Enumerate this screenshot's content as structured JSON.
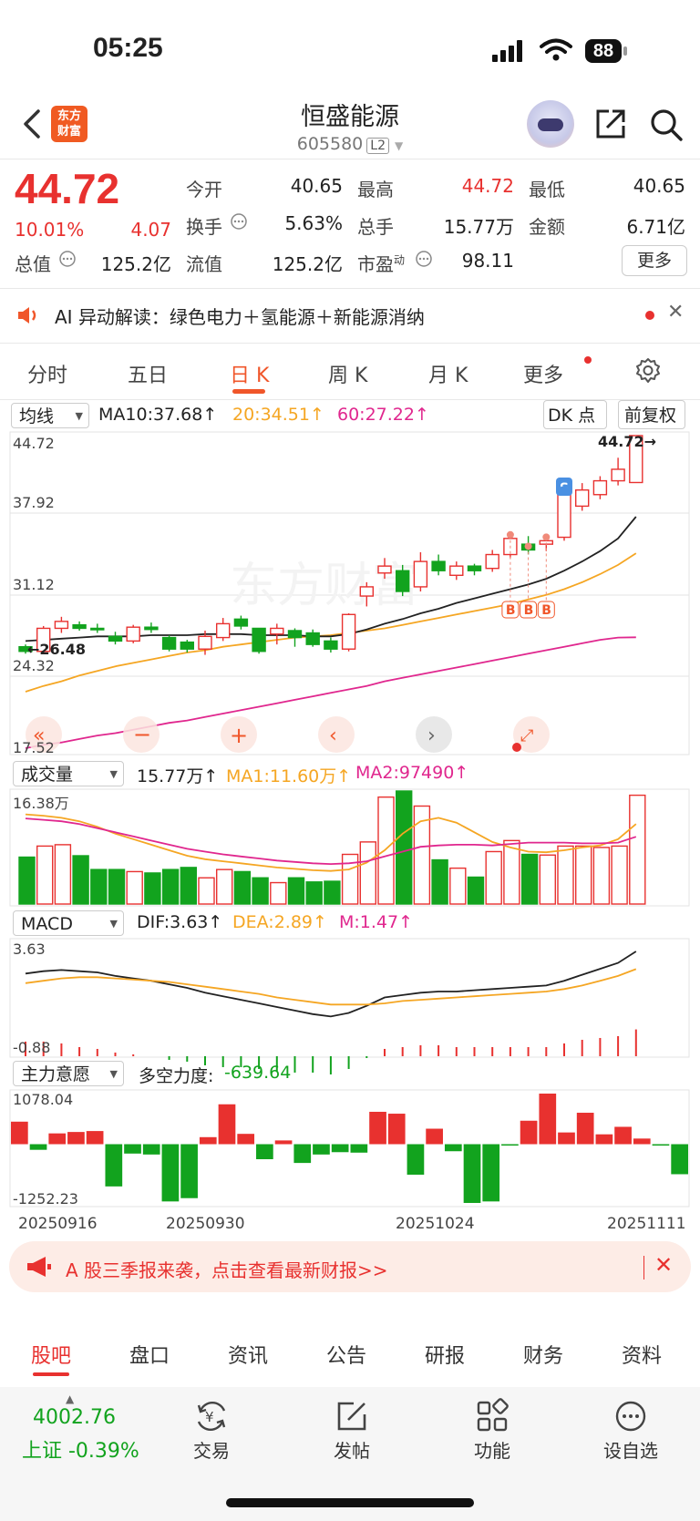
{
  "status": {
    "time": "05:25",
    "battery": "88"
  },
  "header": {
    "name": "恒盛能源",
    "code": "605580",
    "level": "L2",
    "logo_line1": "东方",
    "logo_line2": "财富"
  },
  "quote": {
    "price": "44.72",
    "pct": "10.01%",
    "chg": "4.07",
    "stats": [
      {
        "label": "今开",
        "value": "40.65"
      },
      {
        "label": "最高",
        "value": "44.72"
      },
      {
        "label": "最低",
        "value": "40.65"
      },
      {
        "label": "换手",
        "value": "5.63%"
      },
      {
        "label": "总手",
        "value": "15.77万"
      },
      {
        "label": "金额",
        "value": "6.71亿"
      },
      {
        "label": "总值",
        "value": "125.2亿"
      },
      {
        "label": "流值",
        "value": "125.2亿"
      },
      {
        "label": "市盈",
        "sup": "动",
        "value": "98.11"
      }
    ],
    "more": "更多"
  },
  "ai": {
    "text": "AI 异动解读：绿色电力＋氢能源＋新能源消纳",
    "close": "✕"
  },
  "tabs": [
    "分时",
    "五日",
    "日 K",
    "周 K",
    "月 K",
    "更多"
  ],
  "kline": {
    "selector": "均线",
    "ma10": "MA10:37.68↑",
    "ma20": "20:34.51↑",
    "ma60": "60:27.22↑",
    "dk": "DK 点",
    "fq": "前复权",
    "ylabels": [
      "44.72",
      "37.92",
      "31.12",
      "24.32",
      "17.52"
    ],
    "high_label": "44.72→",
    "low_label": "←26.48",
    "watermark": "东方财富",
    "signal_s": "S",
    "signal_b": "B",
    "colors": {
      "up": "#e8312f",
      "down": "#12a31e",
      "ma10": "#222222",
      "ma20": "#f5a623",
      "ma60": "#e0278e"
    }
  },
  "volume": {
    "selector": "成交量",
    "value": "15.77万↑",
    "ma1": "MA1:11.60万↑",
    "ma2": "MA2:97490↑",
    "ymax": "16.38万"
  },
  "macd": {
    "selector": "MACD",
    "dif": "DIF:3.63↑",
    "dea": "DEA:2.89↑",
    "m": "M:1.47↑",
    "ymax": "3.63",
    "ymin": "-0.88"
  },
  "mainforce": {
    "selector": "主力意愿",
    "label": "多空力度:",
    "value": "-639.64",
    "ymax": "1078.04",
    "ymin": "-1252.23"
  },
  "dates": [
    "20250916",
    "20250930",
    "20251024",
    "20251111"
  ],
  "chart_data": {
    "type": "candlestick",
    "candles": [
      {
        "o": 26.4,
        "c": 26.0,
        "h": 26.6,
        "l": 25.8
      },
      {
        "o": 26.0,
        "c": 28.0,
        "h": 28.2,
        "l": 25.8
      },
      {
        "o": 28.0,
        "c": 28.6,
        "h": 29.0,
        "l": 27.6
      },
      {
        "o": 28.3,
        "c": 28.0,
        "h": 28.6,
        "l": 27.8
      },
      {
        "o": 28.0,
        "c": 27.9,
        "h": 28.4,
        "l": 27.6
      },
      {
        "o": 27.3,
        "c": 26.9,
        "h": 27.7,
        "l": 26.6
      },
      {
        "o": 26.9,
        "c": 28.1,
        "h": 28.3,
        "l": 26.7
      },
      {
        "o": 28.1,
        "c": 27.9,
        "h": 28.5,
        "l": 27.6
      },
      {
        "o": 27.2,
        "c": 26.2,
        "h": 27.4,
        "l": 26.0
      },
      {
        "o": 26.8,
        "c": 26.2,
        "h": 27.0,
        "l": 25.9
      },
      {
        "o": 26.2,
        "c": 27.3,
        "h": 27.8,
        "l": 25.7
      },
      {
        "o": 27.2,
        "c": 28.4,
        "h": 28.9,
        "l": 26.9
      },
      {
        "o": 28.8,
        "c": 28.2,
        "h": 29.1,
        "l": 27.9
      },
      {
        "o": 28.0,
        "c": 26.0,
        "h": 28.0,
        "l": 25.8
      },
      {
        "o": 27.5,
        "c": 28.0,
        "h": 28.4,
        "l": 26.6
      },
      {
        "o": 27.8,
        "c": 27.2,
        "h": 28.0,
        "l": 26.4
      },
      {
        "o": 27.6,
        "c": 26.6,
        "h": 27.9,
        "l": 26.4
      },
      {
        "o": 26.9,
        "c": 26.2,
        "h": 27.2,
        "l": 25.9
      },
      {
        "o": 26.2,
        "c": 29.2,
        "h": 29.3,
        "l": 26.0
      },
      {
        "o": 30.8,
        "c": 31.6,
        "h": 32.0,
        "l": 29.9
      },
      {
        "o": 32.8,
        "c": 33.4,
        "h": 34.1,
        "l": 32.3
      },
      {
        "o": 33.0,
        "c": 31.2,
        "h": 33.5,
        "l": 30.8
      },
      {
        "o": 31.6,
        "c": 33.8,
        "h": 34.6,
        "l": 31.2
      },
      {
        "o": 33.8,
        "c": 33.0,
        "h": 34.4,
        "l": 32.6
      },
      {
        "o": 32.6,
        "c": 33.4,
        "h": 33.8,
        "l": 32.2
      },
      {
        "o": 33.4,
        "c": 33.0,
        "h": 33.6,
        "l": 32.6
      },
      {
        "o": 33.2,
        "c": 34.4,
        "h": 34.8,
        "l": 32.9
      },
      {
        "o": 34.4,
        "c": 35.8,
        "h": 36.3,
        "l": 34.1
      },
      {
        "o": 35.3,
        "c": 34.8,
        "h": 36.0,
        "l": 34.4
      },
      {
        "o": 35.3,
        "c": 35.6,
        "h": 36.1,
        "l": 34.7
      },
      {
        "o": 35.9,
        "c": 39.7,
        "h": 39.9,
        "l": 35.6
      },
      {
        "o": 38.6,
        "c": 40.0,
        "h": 40.6,
        "l": 38.2
      },
      {
        "o": 39.6,
        "c": 40.8,
        "h": 41.2,
        "l": 39.2
      },
      {
        "o": 40.8,
        "c": 41.8,
        "h": 42.8,
        "l": 40.4
      },
      {
        "o": 40.65,
        "c": 44.72,
        "h": 44.72,
        "l": 40.65
      }
    ],
    "ma10": [
      26.9,
      27.0,
      27.1,
      27.2,
      27.3,
      27.3,
      27.3,
      27.4,
      27.4,
      27.4,
      27.5,
      27.5,
      27.5,
      27.4,
      27.4,
      27.4,
      27.3,
      27.3,
      27.5,
      27.9,
      28.4,
      28.8,
      29.3,
      29.7,
      30.2,
      30.6,
      31.0,
      31.4,
      31.8,
      32.3,
      33.0,
      33.8,
      34.7,
      35.8,
      37.68
    ],
    "ma20": [
      22.5,
      23.0,
      23.4,
      23.9,
      24.3,
      24.7,
      25.0,
      25.3,
      25.6,
      25.9,
      26.1,
      26.4,
      26.6,
      26.8,
      27.0,
      27.2,
      27.3,
      27.4,
      27.6,
      27.8,
      28.0,
      28.3,
      28.6,
      28.9,
      29.2,
      29.5,
      29.8,
      30.1,
      30.5,
      30.9,
      31.4,
      32.0,
      32.7,
      33.5,
      34.51
    ],
    "ma60": [
      17.6,
      17.9,
      18.1,
      18.4,
      18.7,
      18.9,
      19.2,
      19.5,
      19.8,
      20.0,
      20.3,
      20.6,
      20.9,
      21.2,
      21.5,
      21.8,
      22.1,
      22.4,
      22.7,
      23.0,
      23.4,
      23.7,
      24.0,
      24.3,
      24.6,
      24.9,
      25.2,
      25.5,
      25.8,
      26.1,
      26.4,
      26.7,
      27.0,
      27.2,
      27.22
    ],
    "volume": [
      6.8,
      8.4,
      8.6,
      7.0,
      5.0,
      5.0,
      4.7,
      4.5,
      5.0,
      5.3,
      3.8,
      5.0,
      4.7,
      3.8,
      3.1,
      3.8,
      3.2,
      3.3,
      7.2,
      9.0,
      15.5,
      16.38,
      14.2,
      6.4,
      5.2,
      3.9,
      7.6,
      9.2,
      7.2,
      7.1,
      8.4,
      8.4,
      8.2,
      8.4,
      15.77
    ],
    "vol_ma1": [
      13.0,
      12.8,
      12.5,
      12.0,
      11.2,
      10.2,
      9.4,
      8.6,
      7.8,
      7.0,
      6.5,
      6.2,
      5.9,
      5.6,
      5.3,
      5.1,
      4.9,
      4.8,
      5.0,
      6.0,
      7.8,
      10.2,
      12.0,
      12.5,
      11.8,
      10.4,
      9.0,
      8.2,
      7.6,
      7.5,
      7.8,
      8.2,
      8.5,
      9.4,
      11.6
    ],
    "vol_ma2": [
      12.4,
      12.2,
      12.0,
      11.6,
      11.0,
      10.4,
      9.8,
      9.2,
      8.6,
      8.0,
      7.6,
      7.2,
      6.9,
      6.6,
      6.3,
      6.1,
      5.9,
      5.8,
      5.9,
      6.2,
      6.9,
      7.6,
      8.3,
      8.5,
      8.6,
      8.6,
      8.5,
      8.7,
      8.9,
      8.9,
      8.9,
      8.8,
      8.8,
      8.9,
      9.749
    ],
    "dif": [
      2.7,
      2.8,
      2.85,
      2.8,
      2.75,
      2.6,
      2.5,
      2.4,
      2.25,
      2.1,
      1.9,
      1.75,
      1.6,
      1.45,
      1.3,
      1.15,
      1.0,
      0.9,
      1.05,
      1.35,
      1.7,
      1.8,
      1.9,
      1.95,
      1.95,
      2.0,
      2.05,
      2.1,
      2.15,
      2.2,
      2.4,
      2.65,
      2.9,
      3.15,
      3.63
    ],
    "dea": [
      2.3,
      2.4,
      2.5,
      2.55,
      2.55,
      2.5,
      2.45,
      2.4,
      2.35,
      2.25,
      2.15,
      2.05,
      1.95,
      1.85,
      1.7,
      1.6,
      1.5,
      1.4,
      1.4,
      1.4,
      1.45,
      1.55,
      1.6,
      1.65,
      1.7,
      1.75,
      1.8,
      1.85,
      1.9,
      1.95,
      2.05,
      2.2,
      2.4,
      2.6,
      2.89
    ],
    "macd_m": [
      0.8,
      0.8,
      0.7,
      0.5,
      0.4,
      0.2,
      0.1,
      0.0,
      -0.2,
      -0.3,
      -0.5,
      -0.6,
      -0.6,
      -0.7,
      -0.8,
      -0.9,
      -0.9,
      -1.0,
      -0.7,
      -0.1,
      0.4,
      0.5,
      0.6,
      0.6,
      0.5,
      0.5,
      0.5,
      0.5,
      0.5,
      0.5,
      0.7,
      0.9,
      1.0,
      1.1,
      1.47
    ],
    "mainforce": [
      480,
      -120,
      230,
      260,
      280,
      -900,
      -200,
      -220,
      -1220,
      -1150,
      150,
      850,
      220,
      -320,
      80,
      -400,
      -220,
      -170,
      -180,
      690,
      650,
      -650,
      330,
      -150,
      -1252,
      -1220,
      -30,
      500,
      1078,
      250,
      670,
      210,
      370,
      120,
      -30,
      -640
    ]
  },
  "promo": {
    "text": "A 股三季报来袭，点击查看最新财报>>",
    "close": "✕"
  },
  "bottom_tabs": [
    "股吧",
    "盘口",
    "资讯",
    "公告",
    "研报",
    "财务",
    "资料"
  ],
  "bottom_bar": {
    "index_value": "4002.76",
    "index_name": "上证 -0.39%",
    "items": [
      "交易",
      "发帖",
      "功能",
      "设自选"
    ]
  }
}
